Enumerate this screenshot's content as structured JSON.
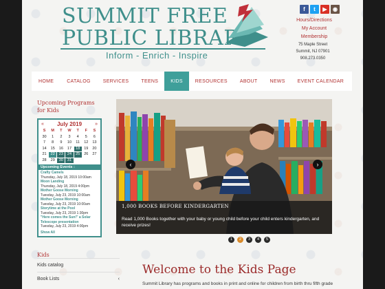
{
  "header": {
    "logo_line1": "SUMMIT FREE",
    "logo_line2": "PUBLIC LIBRARY",
    "tagline": "Inform - Enrich - Inspire",
    "social": [
      {
        "icon": "facebook-icon",
        "glyph": "f",
        "color": "#3b5998"
      },
      {
        "icon": "twitter-icon",
        "glyph": "t",
        "color": "#1da1f2"
      },
      {
        "icon": "youtube-icon",
        "glyph": "▶",
        "color": "#d93025"
      },
      {
        "icon": "instagram-icon",
        "glyph": "◉",
        "color": "#6a5446"
      }
    ],
    "links": [
      "Hours/Directions",
      "My Account",
      "Membership"
    ],
    "address": [
      "75 Maple Street",
      "Summit, NJ 07901",
      "908.273.0350"
    ]
  },
  "nav": {
    "items": [
      "HOME",
      "CATALOG",
      "SERVICES",
      "TEENS",
      "KIDS",
      "RESOURCES",
      "ABOUT",
      "NEWS",
      "EVENT CALENDAR"
    ],
    "active": "KIDS"
  },
  "sidebar": {
    "title": "Upcoming Programs for Kids",
    "calendar": {
      "month": "July 2019",
      "prev": "«",
      "next": "»",
      "dow": [
        "S",
        "M",
        "T",
        "W",
        "T",
        "F",
        "S"
      ],
      "days": [
        "30",
        "1",
        "2",
        "3",
        "4",
        "5",
        "6",
        "7",
        "8",
        "9",
        "10",
        "11",
        "12",
        "13",
        "14",
        "15",
        "16",
        "17",
        "18",
        "19",
        "20",
        "21",
        "22",
        "23",
        "24",
        "25",
        "26",
        "27",
        "28",
        "29",
        "30",
        "31",
        "",
        "",
        ""
      ],
      "event_days": [
        "18",
        "23",
        "24",
        "25",
        "30",
        "31"
      ],
      "highlight_days": [
        "22"
      ]
    },
    "events_label": "Upcoming Events :",
    "events": [
      {
        "name": "Crafty Camels",
        "date": "Thursday, July 18, 2019 10:00am"
      },
      {
        "name": "Moon Landing",
        "date": "Thursday, July 18, 2019 4:00pm"
      },
      {
        "name": "Mother Goose Morning",
        "date": "Tuesday, July 23, 2019 10:00am"
      },
      {
        "name": "Mother Goose Morning",
        "date": "Tuesday, July 23, 2019 10:00am"
      },
      {
        "name": "Storytime at the Pool",
        "date": "Tuesday, July 23, 2019 1:30pm"
      },
      {
        "name": "\"Here comes the Sun!\" a Solar Telescope presentation",
        "date": "Tuesday, July 23, 2019 4:00pm"
      }
    ],
    "show_all": "Show All",
    "section2_title": "Kids",
    "section2_items": [
      {
        "label": "Kids catalog",
        "chevron": ""
      },
      {
        "label": "Book Lists",
        "chevron": "‹"
      }
    ]
  },
  "slider": {
    "heading": "1,000 BOOKS BEFORE KINDERGARTEN",
    "body": "Read 1,000 Books together with your baby or young child before your child enters kindergarten, and receive prizes!",
    "prev": "‹",
    "next": "›",
    "pages": [
      "1",
      "2",
      "3",
      "4",
      "5"
    ],
    "active_page": "2"
  },
  "main": {
    "welcome": "Welcome to the Kids Page",
    "intro": "Summit Library has programs and books in print and online for children from birth thru fifth grade"
  }
}
